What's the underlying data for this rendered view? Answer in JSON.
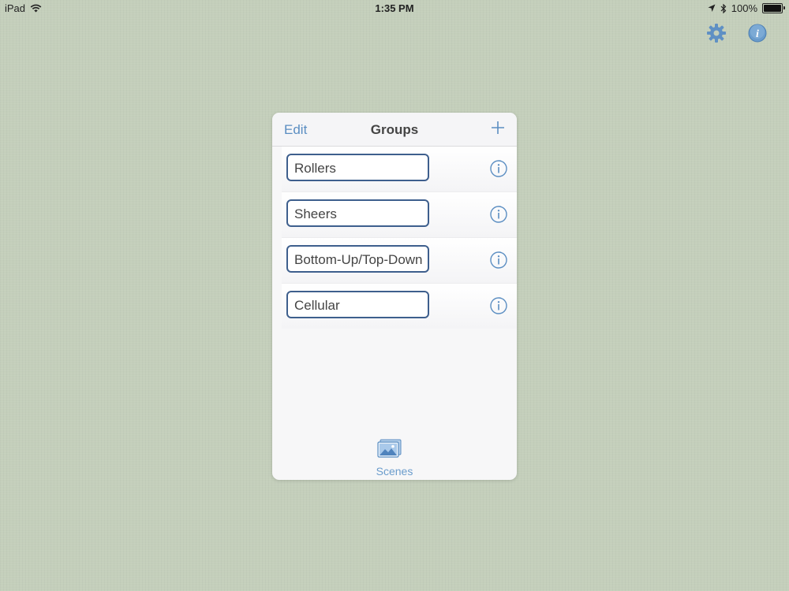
{
  "status_bar": {
    "device": "iPad",
    "time": "1:35 PM",
    "battery": "100%"
  },
  "top_icons": [
    "gear-icon",
    "info-icon"
  ],
  "panel": {
    "edit_label": "Edit",
    "title": "Groups",
    "groups": [
      {
        "name": "Rollers"
      },
      {
        "name": "Sheers"
      },
      {
        "name": "Bottom-Up/Top-Down"
      },
      {
        "name": "Cellular"
      }
    ],
    "tab": {
      "label": "Scenes",
      "icon": "scenes-icon"
    }
  },
  "colors": {
    "accent": "#5b8ec2",
    "field_border": "#3e5f8d",
    "background": "#c4cfbb"
  }
}
